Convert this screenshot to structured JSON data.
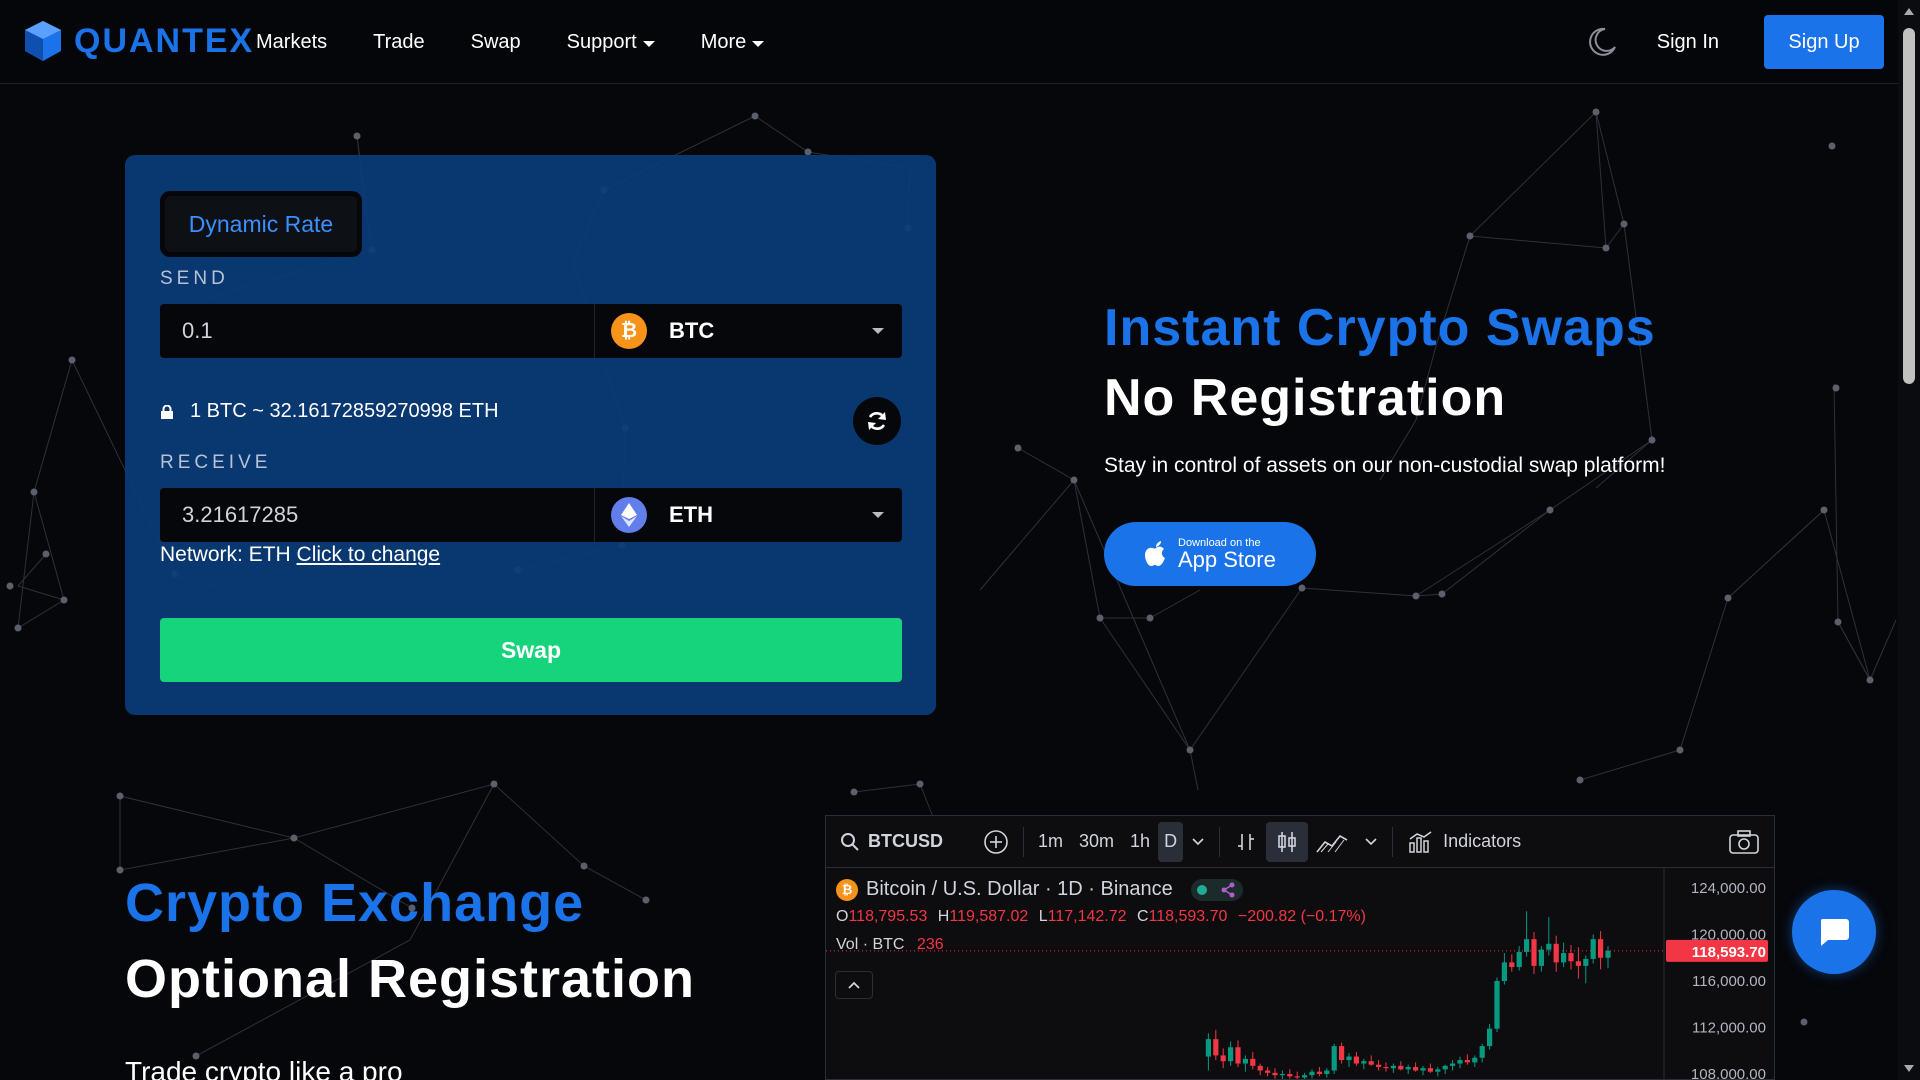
{
  "brand": {
    "name": "QUANTEX",
    "accent": "#1a73e8",
    "success": "#16d47b"
  },
  "nav": {
    "links": [
      {
        "label": "Markets",
        "dropdown": false
      },
      {
        "label": "Trade",
        "dropdown": false
      },
      {
        "label": "Swap",
        "dropdown": false
      },
      {
        "label": "Support",
        "dropdown": true
      },
      {
        "label": "More",
        "dropdown": true
      }
    ],
    "sign_in": "Sign In",
    "sign_up": "Sign Up",
    "theme_icon": "moon-icon"
  },
  "swap": {
    "rate_mode": "Dynamic Rate",
    "send_label": "SEND",
    "send_amount": "0.1",
    "send_currency": "BTC",
    "rate_text": "1 BTC ~ 32.16172859270998 ETH",
    "receive_label": "RECEIVE",
    "receive_amount": "3.21617285",
    "receive_currency": "ETH",
    "network_prefix": "Network: ETH",
    "network_link": "Click to change",
    "button": "Swap"
  },
  "hero": {
    "title_1": "Instant Crypto Swaps",
    "title_2": "No Registration",
    "subtitle": "Stay in control of assets on our non-custodial swap platform!",
    "appstore_small": "Download on the",
    "appstore_big": "App Store"
  },
  "section2": {
    "title_1": "Crypto Exchange",
    "title_2": "Optional Registration",
    "body": "Trade crypto like a pro"
  },
  "chart_widget": {
    "symbol": "BTCUSD",
    "intervals": [
      "1m",
      "30m",
      "1h",
      "D"
    ],
    "active_interval": "D",
    "indicators_label": "Indicators",
    "legend_title": "Bitcoin / U.S. Dollar · 1D · Binance",
    "ohlc": {
      "o_label": "O",
      "o": "118,795.53",
      "h_label": "H",
      "h": "119,587.02",
      "l_label": "L",
      "l": "117,142.72",
      "c_label": "C",
      "c": "118,593.70",
      "change": "−200.82 (−0.17%)"
    },
    "vol_label": "Vol · BTC",
    "vol_value": "236",
    "last_price": "118,593.70"
  },
  "chart_data": {
    "type": "candlestick",
    "title": "Bitcoin / U.S. Dollar · 1D · Binance",
    "y_ticks": [
      "124,000.00",
      "120,000.00",
      "116,000.00",
      "112,000.00",
      "108,000.00"
    ],
    "ylim": [
      108000,
      124000
    ],
    "last_price": 118593.7,
    "candles": [
      {
        "o": 109500,
        "h": 111500,
        "l": 108300,
        "c": 111000
      },
      {
        "o": 111000,
        "h": 111800,
        "l": 109200,
        "c": 109600
      },
      {
        "o": 109600,
        "h": 110200,
        "l": 108500,
        "c": 109100
      },
      {
        "o": 109100,
        "h": 110800,
        "l": 108700,
        "c": 110300
      },
      {
        "o": 110300,
        "h": 110900,
        "l": 108600,
        "c": 108900
      },
      {
        "o": 108900,
        "h": 109600,
        "l": 108200,
        "c": 109300
      },
      {
        "o": 109300,
        "h": 109900,
        "l": 108400,
        "c": 108700
      },
      {
        "o": 108700,
        "h": 108900,
        "l": 107900,
        "c": 108300
      },
      {
        "o": 108300,
        "h": 108600,
        "l": 107800,
        "c": 108100
      },
      {
        "o": 108100,
        "h": 108500,
        "l": 107600,
        "c": 107900
      },
      {
        "o": 107900,
        "h": 108300,
        "l": 107500,
        "c": 108000
      },
      {
        "o": 108000,
        "h": 108400,
        "l": 107600,
        "c": 107800
      },
      {
        "o": 107800,
        "h": 108200,
        "l": 107400,
        "c": 107700
      },
      {
        "o": 107700,
        "h": 108100,
        "l": 107300,
        "c": 107900
      },
      {
        "o": 107900,
        "h": 108400,
        "l": 107600,
        "c": 108200
      },
      {
        "o": 108200,
        "h": 108600,
        "l": 107800,
        "c": 108000
      },
      {
        "o": 108000,
        "h": 108500,
        "l": 107700,
        "c": 108300
      },
      {
        "o": 108300,
        "h": 110600,
        "l": 108000,
        "c": 110400
      },
      {
        "o": 110400,
        "h": 110700,
        "l": 108900,
        "c": 109200
      },
      {
        "o": 109200,
        "h": 109800,
        "l": 108600,
        "c": 109500
      },
      {
        "o": 109500,
        "h": 109900,
        "l": 108700,
        "c": 108900
      },
      {
        "o": 108900,
        "h": 109300,
        "l": 108400,
        "c": 109100
      },
      {
        "o": 109100,
        "h": 109600,
        "l": 108700,
        "c": 108800
      },
      {
        "o": 108800,
        "h": 109200,
        "l": 108300,
        "c": 108600
      },
      {
        "o": 108600,
        "h": 109000,
        "l": 108200,
        "c": 108500
      },
      {
        "o": 108500,
        "h": 108900,
        "l": 108100,
        "c": 108700
      },
      {
        "o": 108700,
        "h": 109100,
        "l": 108300,
        "c": 108400
      },
      {
        "o": 108400,
        "h": 108800,
        "l": 108000,
        "c": 108600
      },
      {
        "o": 108600,
        "h": 109000,
        "l": 108200,
        "c": 108300
      },
      {
        "o": 108300,
        "h": 108700,
        "l": 107900,
        "c": 108500
      },
      {
        "o": 108500,
        "h": 108900,
        "l": 108100,
        "c": 108200
      },
      {
        "o": 108200,
        "h": 108600,
        "l": 107800,
        "c": 108400
      },
      {
        "o": 108400,
        "h": 108800,
        "l": 108000,
        "c": 108700
      },
      {
        "o": 108700,
        "h": 109200,
        "l": 108300,
        "c": 108900
      },
      {
        "o": 108900,
        "h": 109500,
        "l": 108500,
        "c": 109200
      },
      {
        "o": 109200,
        "h": 109700,
        "l": 108800,
        "c": 109000
      },
      {
        "o": 109000,
        "h": 109600,
        "l": 108600,
        "c": 109400
      },
      {
        "o": 109400,
        "h": 110600,
        "l": 109000,
        "c": 110400
      },
      {
        "o": 110400,
        "h": 112300,
        "l": 110100,
        "c": 111900
      },
      {
        "o": 111900,
        "h": 116300,
        "l": 111600,
        "c": 116000
      },
      {
        "o": 116000,
        "h": 118400,
        "l": 115700,
        "c": 117600
      },
      {
        "o": 117600,
        "h": 118300,
        "l": 116800,
        "c": 117200
      },
      {
        "o": 117200,
        "h": 119000,
        "l": 116900,
        "c": 118500
      },
      {
        "o": 118500,
        "h": 122000,
        "l": 118100,
        "c": 119600
      },
      {
        "o": 119600,
        "h": 120200,
        "l": 116600,
        "c": 117300
      },
      {
        "o": 117300,
        "h": 119000,
        "l": 116800,
        "c": 118700
      },
      {
        "o": 118700,
        "h": 121500,
        "l": 118200,
        "c": 119200
      },
      {
        "o": 119200,
        "h": 119900,
        "l": 116800,
        "c": 117600
      },
      {
        "o": 117600,
        "h": 119300,
        "l": 117200,
        "c": 118400
      },
      {
        "o": 118400,
        "h": 119100,
        "l": 117000,
        "c": 117700
      },
      {
        "o": 117700,
        "h": 118900,
        "l": 116200,
        "c": 117300
      },
      {
        "o": 117300,
        "h": 118200,
        "l": 115800,
        "c": 117900
      },
      {
        "o": 117900,
        "h": 120000,
        "l": 117500,
        "c": 119600
      },
      {
        "o": 119600,
        "h": 120300,
        "l": 117000,
        "c": 118000
      },
      {
        "o": 118000,
        "h": 119000,
        "l": 117100,
        "c": 118600
      }
    ]
  }
}
